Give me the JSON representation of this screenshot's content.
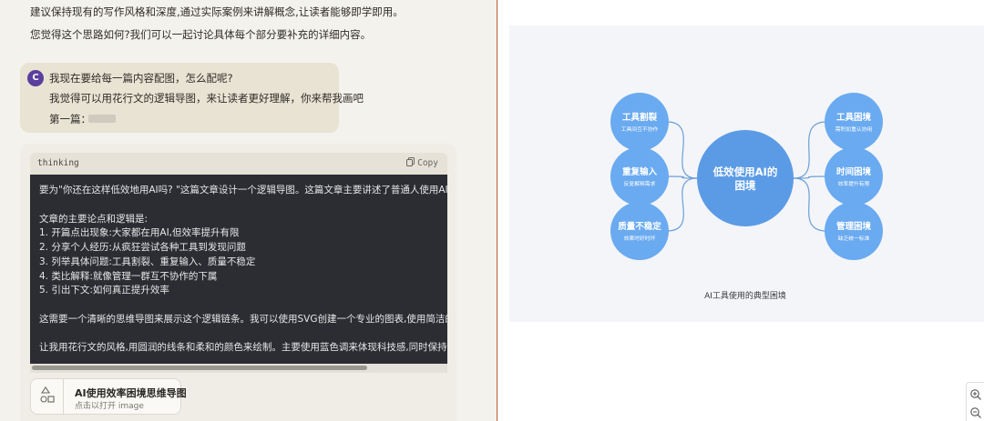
{
  "chat": {
    "prev_paragraphs": [
      "建议保持现有的写作风格和深度,通过实际案例来讲解概念,让读者能够即学即用。",
      "您觉得这个思路如何?我们可以一起讨论具体每个部分要补充的详细内容。"
    ],
    "user": {
      "avatar_letter": "C",
      "lines": [
        "我现在要给每一篇内容配图，怎么配呢?",
        "我觉得可以用花行文的逻辑导图，来让读者更好理解，你来帮我画吧",
        "第一篇："
      ]
    },
    "code_block": {
      "language": "thinking",
      "copy_label": "Copy",
      "lines": [
        "要为\"你还在这样低效地用AI吗? \"这篇文章设计一个逻辑导图。这篇文章主要讲述了普通人使用AI工具时遇",
        "",
        "文章的主要论点和逻辑是:",
        "1. 开篇点出现象:大家都在用AI,但效率提升有限",
        "2. 分享个人经历:从疯狂尝试各种工具到发现问题",
        "3. 列举具体问题:工具割裂、重复输入、质量不稳定",
        "4. 类比解释:就像管理一群互不协作的下属",
        "5. 引出下文:如何真正提升效率",
        "",
        "这需要一个清晰的思维导图来展示这个逻辑链条。我可以使用SVG创建一个专业的图表,使用简洁的线条和合",
        "",
        "让我用花行文的风格,用圆润的线条和柔和的颜色来绘制。主要使用蓝色调来体现科技感,同时保持温和易读。"
      ]
    },
    "artifact": {
      "title": "AI使用效率困境思维导图",
      "subtitle": "点击以打开 image",
      "icon": "shapes-icon"
    }
  },
  "diagram": {
    "center": "低效使用AI的\n困境",
    "left_nodes": [
      {
        "title": "工具割裂",
        "sub": "工具间互不协作"
      },
      {
        "title": "重复输入",
        "sub": "反复解释需求"
      },
      {
        "title": "质量不稳定",
        "sub": "效果时好时坏"
      }
    ],
    "right_nodes": [
      {
        "title": "工具困境",
        "sub": "需积加重认协用"
      },
      {
        "title": "时间困境",
        "sub": "效率提升有限"
      },
      {
        "title": "管理困境",
        "sub": "缺乏统一标准"
      }
    ],
    "caption": "AI工具使用的典型困境",
    "colors": {
      "center": "#5b9be6",
      "node": "#6aaaf0",
      "edge": "#6b9fd8",
      "text": "#ffffff"
    }
  },
  "zoom": {
    "zoom_in_icon": "zoom-in-icon",
    "zoom_out_icon": "zoom-out-icon"
  }
}
